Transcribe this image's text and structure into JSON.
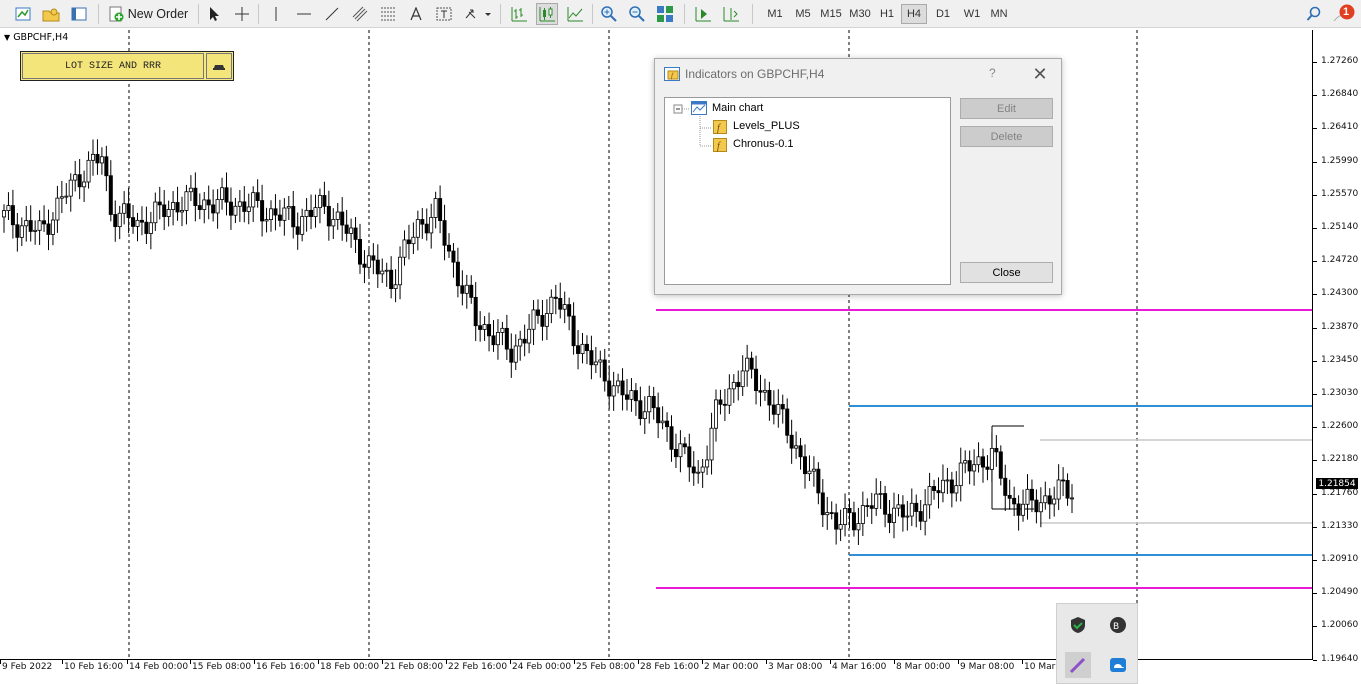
{
  "toolbar": {
    "new_order_label": "New Order",
    "timeframes": [
      "M1",
      "M5",
      "M15",
      "M30",
      "H1",
      "H4",
      "D1",
      "W1",
      "MN"
    ],
    "active_timeframe": "H4",
    "notification_count": "1"
  },
  "chart": {
    "symbol_label": "GBPCHF,H4",
    "lot_button_label": "LOT SIZE AND RRR",
    "current_price": "1.21854",
    "price_axis_labels": [
      "1.27260",
      "1.26840",
      "1.26410",
      "1.25990",
      "1.25570",
      "1.25140",
      "1.24720",
      "1.24300",
      "1.23870",
      "1.23450",
      "1.23030",
      "1.22600",
      "1.22180",
      "1.21760",
      "1.21330",
      "1.20910",
      "1.20490",
      "1.20060",
      "1.19640"
    ],
    "time_axis_labels": [
      "9 Feb 2022",
      "10 Feb 16:00",
      "14 Feb 00:00",
      "15 Feb 08:00",
      "16 Feb 16:00",
      "18 Feb 00:00",
      "21 Feb 08:00",
      "22 Feb 16:00",
      "24 Feb 00:00",
      "25 Feb 08:00",
      "28 Feb 16:00",
      "2 Mar 00:00",
      "3 Mar 08:00",
      "4 Mar 16:00",
      "8 Mar 00:00",
      "9 Mar 08:00",
      "10 Mar"
    ],
    "colors": {
      "magenta_level": "#e81ad8",
      "blue_level": "#2e8fd6",
      "gray_level": "#c8c8c8",
      "candle": "#000000"
    }
  },
  "dialog": {
    "title": "Indicators on GBPCHF,H4",
    "help_label": "?",
    "tree": {
      "root": "Main chart",
      "items": [
        "Levels_PLUS",
        "Chronus-0.1"
      ]
    },
    "edit_label": "Edit",
    "delete_label": "Delete",
    "close_label": "Close"
  }
}
